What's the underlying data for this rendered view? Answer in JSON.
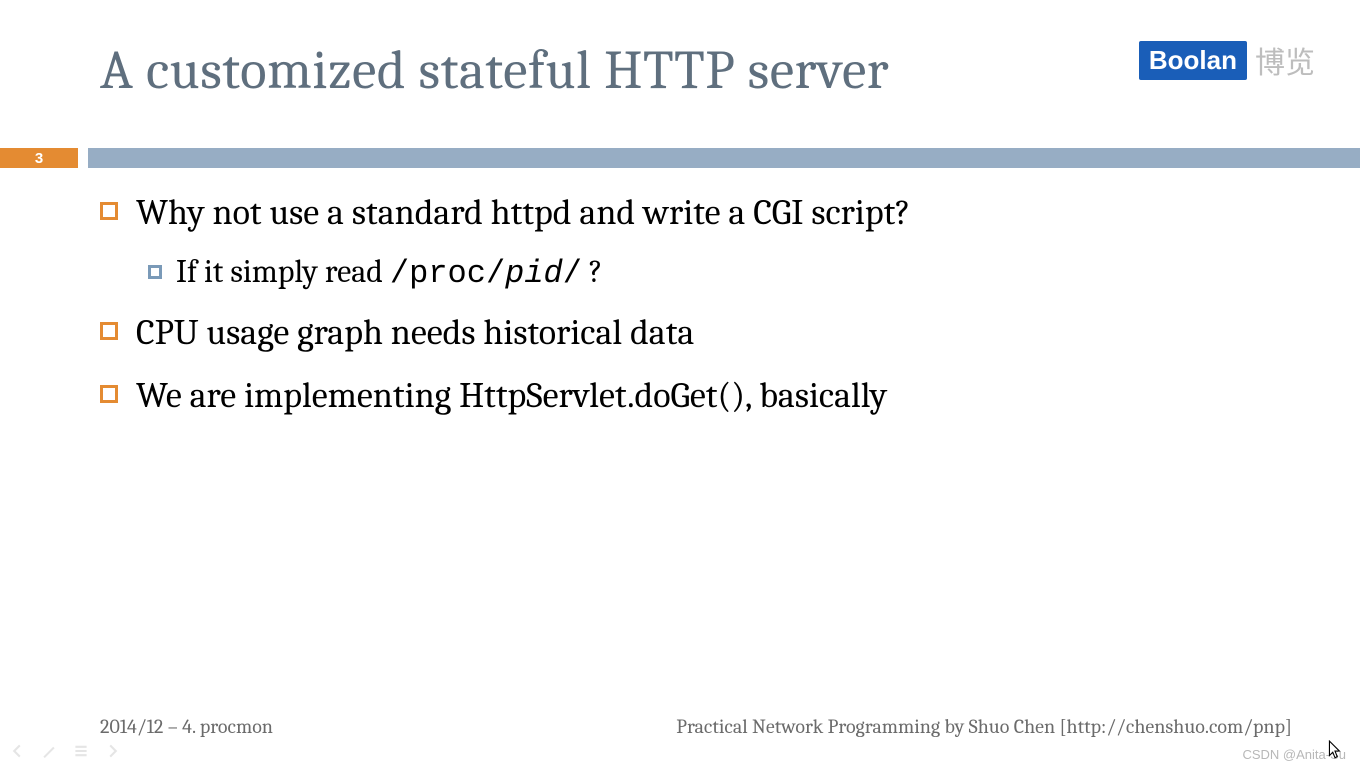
{
  "header": {
    "title": "A customized stateful HTTP server",
    "logo_text": "Boolan",
    "logo_cn": "博览"
  },
  "page_number": "3",
  "bullets": [
    {
      "text": "Why not use a standard httpd and write a CGI script?",
      "sub": {
        "prefix": "If it simply read ",
        "mono1": "/proc/",
        "mono_italic": "pid",
        "mono2": "/",
        "suffix": " ?"
      }
    },
    {
      "text": "CPU usage graph needs historical data"
    },
    {
      "text": "We are implementing HttpServlet.doGet(), basically"
    }
  ],
  "footer": {
    "left": "2014/12 – 4. procmon",
    "right": "Practical Network Programming by Shuo Chen [http://chenshuo.com/pnp]"
  },
  "watermark": "CSDN @Anita-Su",
  "nav": {
    "prev": "prev-icon",
    "pen": "pen-icon",
    "menu": "menu-icon",
    "next": "next-icon"
  }
}
